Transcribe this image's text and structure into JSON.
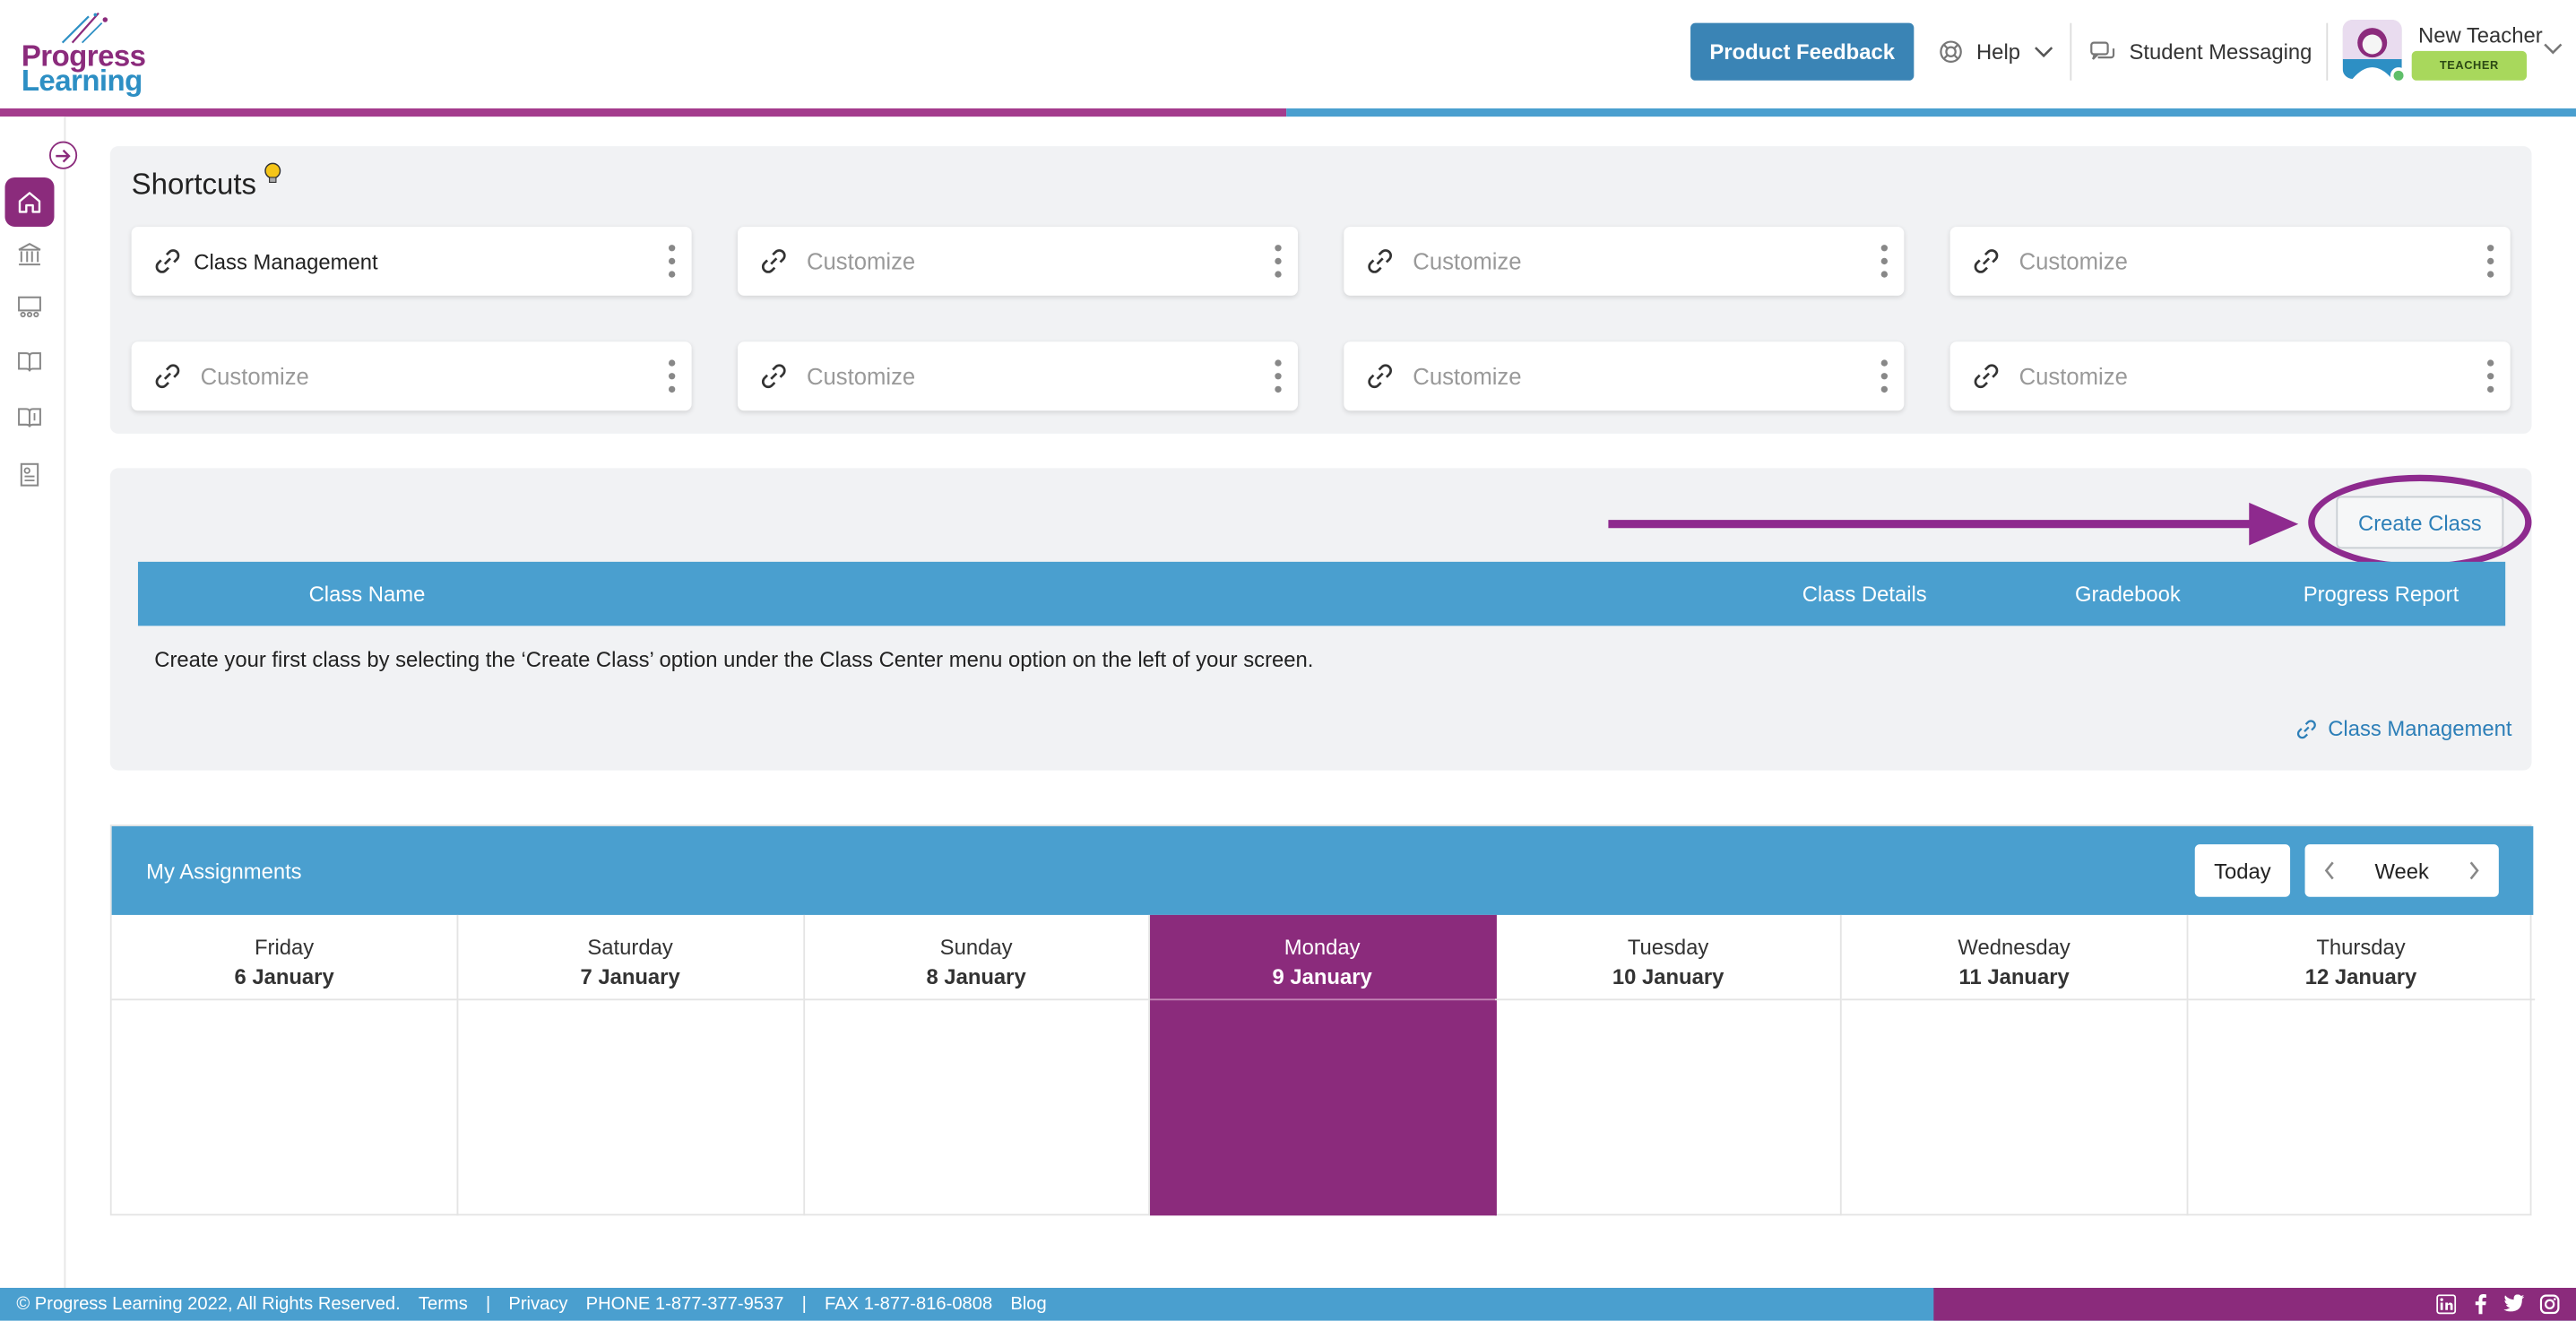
{
  "brand": {
    "line1": "Progress",
    "line2": "Learning",
    "purple": "#8b2b7c",
    "blue": "#4a9fcf"
  },
  "header": {
    "feedback_label": "Product Feedback",
    "help_label": "Help",
    "messaging_label": "Student Messaging",
    "user_name": "New Teacher",
    "user_role": "TEACHER"
  },
  "rail": {
    "items": [
      "home-icon",
      "school-icon",
      "classroom-icon",
      "book-icon",
      "gradebook-icon",
      "report-icon"
    ]
  },
  "shortcuts": {
    "title": "Shortcuts",
    "cards": [
      {
        "label": "Class Management",
        "set": true
      },
      {
        "label": "Customize",
        "set": false
      },
      {
        "label": "Customize",
        "set": false
      },
      {
        "label": "Customize",
        "set": false
      },
      {
        "label": "Customize",
        "set": false
      },
      {
        "label": "Customize",
        "set": false
      },
      {
        "label": "Customize",
        "set": false
      },
      {
        "label": "Customize",
        "set": false
      }
    ]
  },
  "classes": {
    "create_label": "Create Class",
    "columns": {
      "name": "Class Name",
      "details": "Class Details",
      "gradebook": "Gradebook",
      "progress": "Progress Report"
    },
    "empty_message": "Create your first class by selecting the ‘Create Class’ option under the Class Center menu option on the left of your screen.",
    "link_label": "Class Management"
  },
  "assignments": {
    "title": "My Assignments",
    "today_label": "Today",
    "view_label": "Week",
    "days": [
      {
        "name": "Friday",
        "date": "6 January",
        "today": false
      },
      {
        "name": "Saturday",
        "date": "7 January",
        "today": false
      },
      {
        "name": "Sunday",
        "date": "8 January",
        "today": false
      },
      {
        "name": "Monday",
        "date": "9 January",
        "today": true
      },
      {
        "name": "Tuesday",
        "date": "10 January",
        "today": false
      },
      {
        "name": "Wednesday",
        "date": "11 January",
        "today": false
      },
      {
        "name": "Thursday",
        "date": "12 January",
        "today": false
      }
    ]
  },
  "footer": {
    "copyright": "© Progress Learning 2022, All Rights Reserved.",
    "terms": "Terms",
    "sep1": "|",
    "privacy": "Privacy",
    "phone": "PHONE 1-877-377-9537",
    "sep2": "|",
    "fax": "FAX 1-877-816-0808",
    "blog": "Blog",
    "social": [
      "linkedin-icon",
      "facebook-icon",
      "twitter-icon",
      "instagram-icon"
    ]
  }
}
